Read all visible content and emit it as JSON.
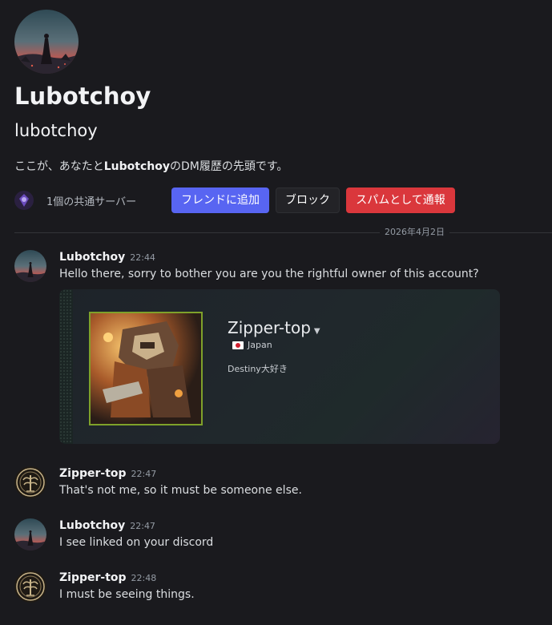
{
  "header": {
    "display_name": "Lubotchoy",
    "username": "lubotchoy",
    "intro_prefix": "ここが、あなたと",
    "intro_name": "Lubotchoy",
    "intro_suffix": "のDM履歴の先頭です。",
    "mutual_servers": "1個の共通サーバー",
    "add_friend_label": "フレンドに追加",
    "block_label": "ブロック",
    "report_spam_label": "スパムとして通報"
  },
  "divider": {
    "date": "2026年4月2日"
  },
  "messages": [
    {
      "author": "Lubotchoy",
      "time": "22:44",
      "text": "Hello there, sorry to bother you are you the rightful owner of this account?",
      "avatar": "lubotchoy-avatar"
    },
    {
      "author": "Zipper-top",
      "time": "22:47",
      "text": "That's not me, so it must be someone else.",
      "avatar": "tree-emblem-avatar"
    },
    {
      "author": "Lubotchoy",
      "time": "22:47",
      "text": "I see linked on your discord",
      "avatar": "lubotchoy-avatar"
    },
    {
      "author": "Zipper-top",
      "time": "22:48",
      "text": "I must be seeing things.",
      "avatar": "tree-emblem-avatar"
    }
  ],
  "embed": {
    "name": "Zipper-top",
    "country": "Japan",
    "bio": "Destiny大好き",
    "accent_border": "#7fa12a"
  },
  "colors": {
    "background": "#1a1a1e",
    "blurple": "#5865f2",
    "danger": "#da373c"
  }
}
